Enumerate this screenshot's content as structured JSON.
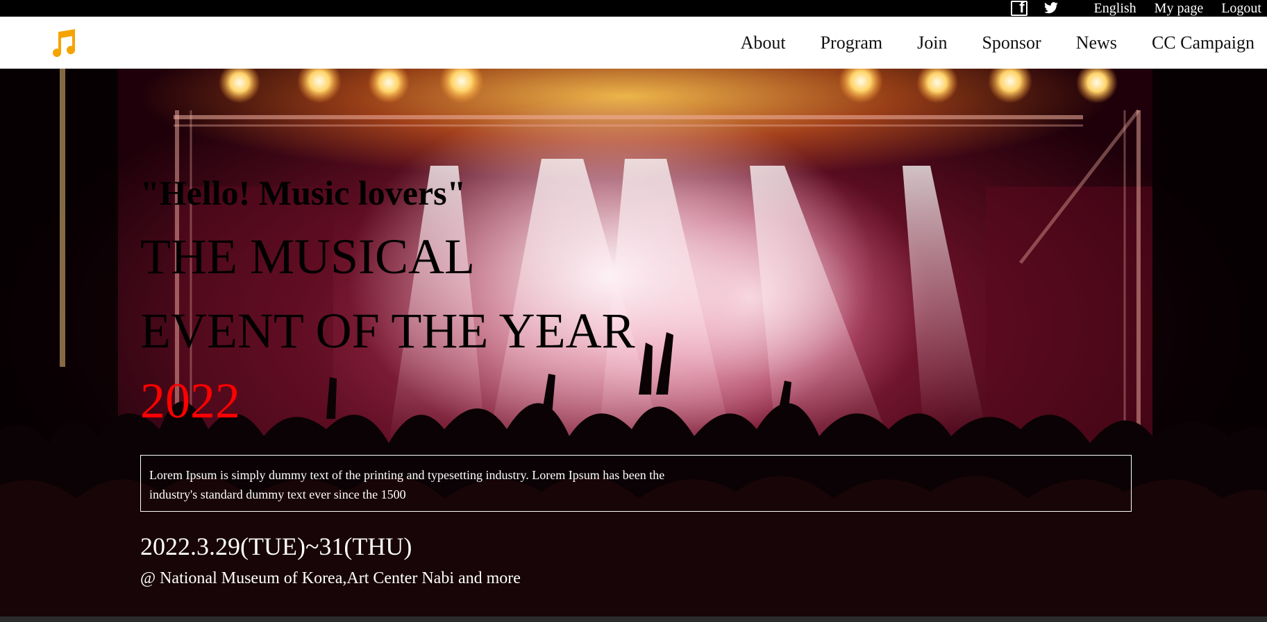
{
  "topbar": {
    "facebook_icon": "facebook-icon",
    "twitter_icon": "twitter-icon",
    "links": [
      "English",
      "My page",
      "Logout"
    ]
  },
  "navbar": {
    "logo_icon": "music-note-icon",
    "logo_color": "#f5a300",
    "menu": [
      "About",
      "Program",
      "Join",
      "Sponsor",
      "News",
      "CC Campaign"
    ]
  },
  "hero": {
    "greeting": "\"Hello! Music lovers\"",
    "headline_line1": "THE MUSICAL",
    "headline_line2": "EVENT OF THE YEAR",
    "year": "2022",
    "year_color": "#ff0000",
    "description": "Lorem Ipsum is simply dummy text of the printing and typesetting industry. Lorem Ipsum has been the industry's standard dummy text ever since the 1500",
    "date": "2022.3.29(TUE)~31(THU)",
    "venue": "@ National Museum of Korea,Art Center Nabi and more"
  }
}
